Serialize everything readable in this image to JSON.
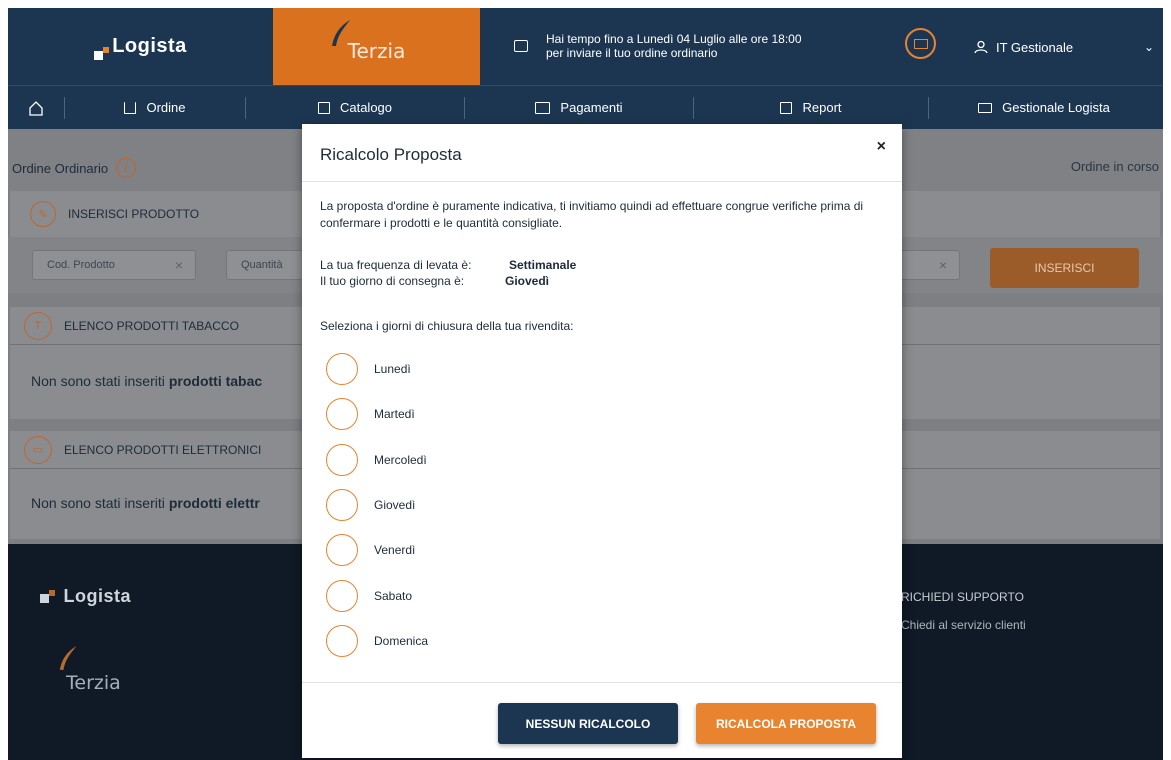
{
  "header": {
    "brand": "Logista",
    "partner": "Terzia",
    "deadline_line1": "Hai tempo fino a Lunedì 04 Luglio alle ore 18:00",
    "deadline_line2": "per inviare il tuo ordine ordinario",
    "user": "IT Gestionale"
  },
  "nav": {
    "items": [
      {
        "label": "Ordine",
        "icon": "cart-icon"
      },
      {
        "label": "Catalogo",
        "icon": "catalog-icon"
      },
      {
        "label": "Pagamenti",
        "icon": "card-icon"
      },
      {
        "label": "Report",
        "icon": "chart-icon"
      },
      {
        "label": "Gestionale Logista",
        "icon": "monitor-icon"
      }
    ]
  },
  "page": {
    "title": "Ordine Ordinario",
    "status": "Ordine in corso",
    "insert_section": "INSERISCI PRODOTTO",
    "cod_placeholder": "Cod. Prodotto",
    "qty_placeholder": "Quantità",
    "insert_button": "INSERISCI",
    "tabacco_section": "ELENCO PRODOTTI TABACCO",
    "tabacco_letter": "T",
    "tabacco_empty_prefix": "Non sono stati inseriti",
    "tabacco_empty_bold": "prodotti tabac",
    "elettronici_section": "ELENCO PRODOTTI ELETTRONICI",
    "elettronici_empty_prefix": "Non sono stati inseriti",
    "elettronici_empty_bold": "prodotti elettr"
  },
  "footer": {
    "brand": "Logista",
    "partner": "Terzia",
    "support_title": "RICHIEDI SUPPORTO",
    "support_sub": "Chiedi al servizio clienti"
  },
  "modal": {
    "title": "Ricalcolo Proposta",
    "close": "×",
    "intro": "La proposta d'ordine è puramente indicativa, ti invitiamo quindi ad effettuare congrue verifiche prima di confermare i prodotti e le quantità consigliate.",
    "frequency_label": "La tua frequenza di levata è:",
    "frequency_value": "Settimanale",
    "delivery_label": "Il tuo giorno di consegna è:",
    "delivery_value": "Giovedì",
    "select_label": "Seleziona i giorni di chiusura della tua rivendita:",
    "days": [
      "Lunedì",
      "Martedì",
      "Mercoledì",
      "Giovedì",
      "Venerdì",
      "Sabato",
      "Domenica"
    ],
    "btn_none": "NESSUN RICALCOLO",
    "btn_recalc": "RICALCOLA PROPOSTA"
  },
  "colors": {
    "navy": "#1c3652",
    "orange": "#e8832f",
    "terzia_orange": "#d9711f"
  }
}
